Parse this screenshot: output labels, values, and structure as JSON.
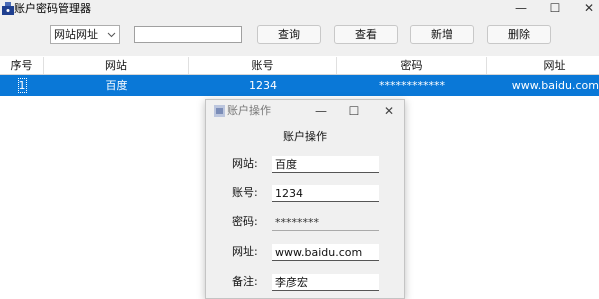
{
  "window": {
    "title": "账户密码管理器",
    "controls": {
      "minimize": "—",
      "maximize": "☐",
      "close": "✕"
    }
  },
  "toolbar": {
    "select_value": "网站网址",
    "search_value": "",
    "buttons": {
      "query": "查询",
      "view": "查看",
      "add": "新增",
      "delete": "删除"
    }
  },
  "grid": {
    "columns": [
      "序号",
      "网站",
      "账号",
      "密码",
      "网址"
    ],
    "rows": [
      {
        "index": "1",
        "site": "百度",
        "account": "1234",
        "password": "************",
        "url": "www.baidu.com"
      }
    ],
    "selected_color": "#0a78d7"
  },
  "dialog": {
    "title": "账户操作",
    "heading": "账户操作",
    "controls": {
      "minimize": "—",
      "maximize": "☐",
      "close": "✕"
    },
    "fields": {
      "site": {
        "label": "网站:",
        "value": "百度"
      },
      "account": {
        "label": "账号:",
        "value": "1234"
      },
      "password": {
        "label": "密码:",
        "value": "********"
      },
      "url": {
        "label": "网址:",
        "value": "www.baidu.com"
      },
      "note": {
        "label": "备注:",
        "value": "李彦宏"
      }
    }
  }
}
